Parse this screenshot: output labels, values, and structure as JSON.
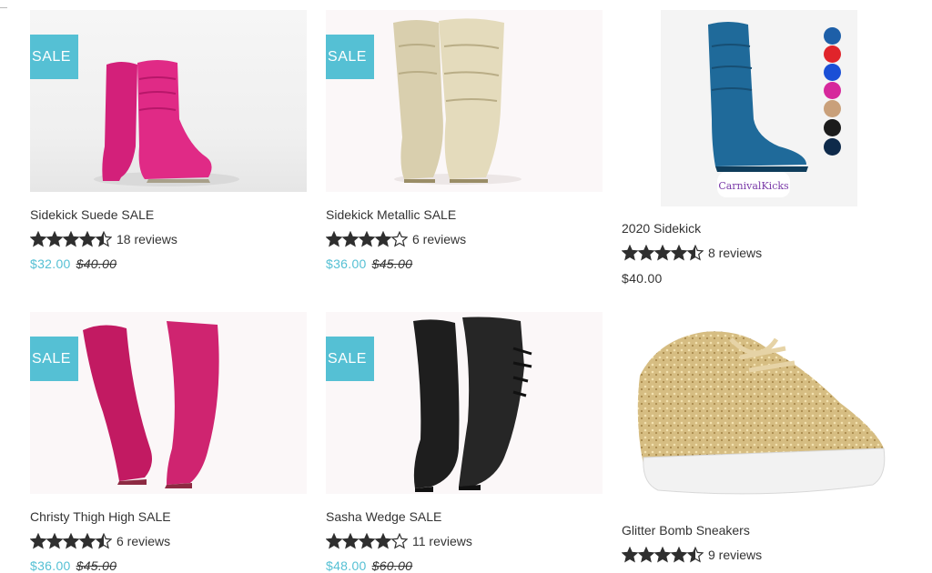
{
  "products": [
    {
      "title": "Sidekick Suede SALE",
      "rating_stars": 4.5,
      "reviews": "18 reviews",
      "price": "$32.00",
      "compare_price": "$40.00",
      "badge": "SALE"
    },
    {
      "title": "Sidekick Metallic SALE",
      "rating_stars": 4,
      "reviews": "6 reviews",
      "price": "$36.00",
      "compare_price": "$45.00",
      "badge": "SALE"
    },
    {
      "title": "2020 Sidekick",
      "rating_stars": 4.5,
      "reviews": "8 reviews",
      "price": "$40.00",
      "logo_text": "CarnivalKicks",
      "swatch_colors": [
        "#1d5fa8",
        "#e0242b",
        "#1a4fd6",
        "#d6289c",
        "#c9a07a",
        "#1c1c1c",
        "#0e2a4a"
      ]
    },
    {
      "title": "Christy Thigh High SALE",
      "rating_stars": 4.5,
      "reviews": "6 reviews",
      "price": "$36.00",
      "compare_price": "$45.00",
      "badge": "SALE"
    },
    {
      "title": "Sasha Wedge SALE",
      "rating_stars": 4,
      "reviews": "11 reviews",
      "price": "$48.00",
      "compare_price": "$60.00",
      "badge": "SALE"
    },
    {
      "title": "Glitter Bomb Sneakers",
      "rating_stars": 4.5,
      "reviews": "9 reviews"
    }
  ],
  "colors": {
    "accent": "#55c0d4",
    "text": "#333333",
    "star": "#2f2f2f"
  }
}
